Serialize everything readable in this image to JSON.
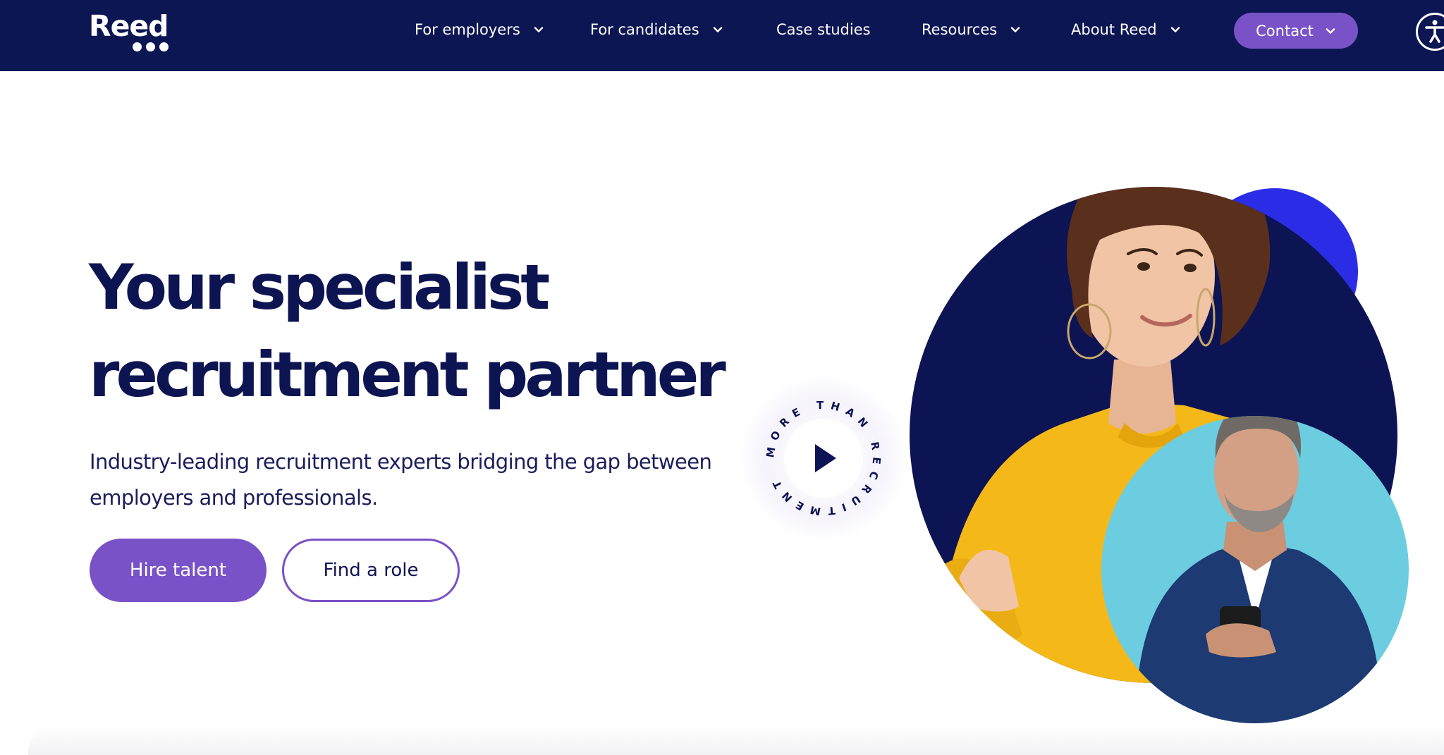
{
  "brand": {
    "name": "Reed"
  },
  "nav": {
    "items": [
      {
        "label": "For employers",
        "has_dropdown": true
      },
      {
        "label": "For candidates",
        "has_dropdown": true
      },
      {
        "label": "Case studies",
        "has_dropdown": false
      },
      {
        "label": "Resources",
        "has_dropdown": true
      },
      {
        "label": "About Reed",
        "has_dropdown": true
      }
    ],
    "contact_label": "Contact",
    "accessibility_icon": "accessibility-icon"
  },
  "hero": {
    "title_line1": "Your specialist",
    "title_line2": "recruitment partner",
    "subtitle_line1": "Industry-leading recruitment experts bridging the gap between",
    "subtitle_line2": "employers and professionals.",
    "primary_cta": "Hire talent",
    "secondary_cta": "Find a role",
    "video_badge_text": "MORE THAN RECRUITMENT •",
    "play_icon": "play-icon"
  },
  "colors": {
    "nav_bg": "#0c1653",
    "accent_purple": "#7a52c7",
    "heading": "#0d1452",
    "circle_navy": "#0c1454",
    "circle_blue": "#2b2de6",
    "circle_cyan": "#6ccde0",
    "sweater_yellow": "#f5b819"
  }
}
